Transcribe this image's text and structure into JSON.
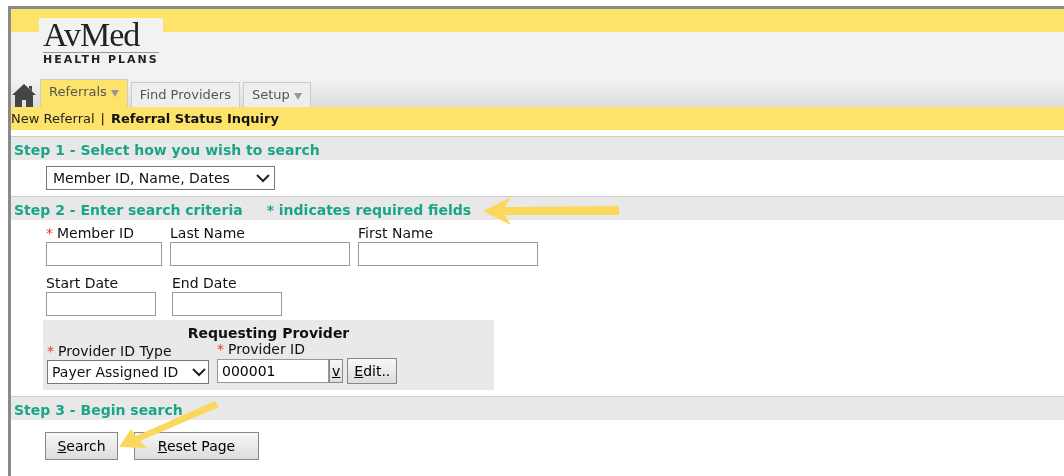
{
  "logo": {
    "name": "AvMed",
    "tagline": "HEALTH PLANS"
  },
  "tabs": [
    {
      "label": "Referrals",
      "selected": true,
      "dropdown": true
    },
    {
      "label": "Find Providers",
      "selected": false,
      "dropdown": false
    },
    {
      "label": "Setup",
      "selected": false,
      "dropdown": true
    }
  ],
  "subnav": [
    {
      "label": "New Referral",
      "selected": false
    },
    {
      "label": "Referral Status Inquiry",
      "selected": true
    }
  ],
  "subnav_separator": "|",
  "step1": {
    "title": "Step 1 - Select how you wish to search",
    "select_value": "Member ID, Name, Dates"
  },
  "step2": {
    "title": "Step 2 - Enter search criteria",
    "note": "* indicates required fields",
    "fields": [
      {
        "label": "Member ID",
        "required": true
      },
      {
        "label": "Last Name",
        "required": false
      },
      {
        "label": "First Name",
        "required": false
      }
    ],
    "date_fields": [
      {
        "label": "Start Date",
        "required": false
      },
      {
        "label": "End Date",
        "required": false
      }
    ],
    "provider": {
      "title": "Requesting Provider",
      "id_type_label": "Provider ID Type",
      "id_type_value": "Payer Assigned ID",
      "id_label": "Provider ID",
      "id_value": "000001",
      "lookup_button": "v",
      "edit_button": "Edit.."
    }
  },
  "step3": {
    "title": "Step 3 - Begin search",
    "buttons": [
      "Search",
      "Reset Page"
    ]
  },
  "required_mark": "*"
}
